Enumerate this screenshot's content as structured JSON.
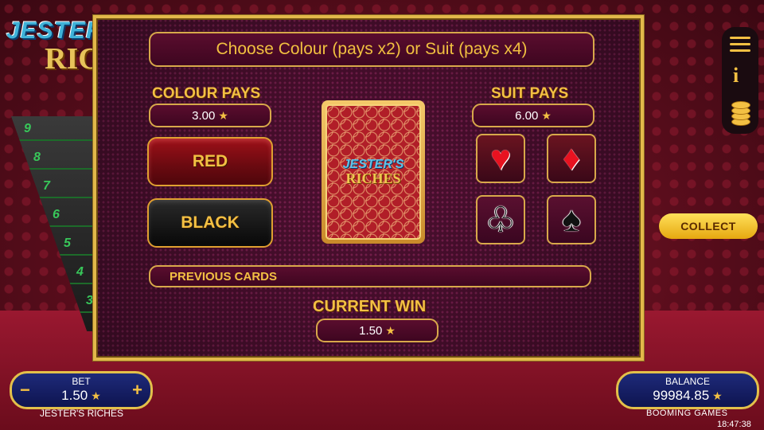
{
  "dialog": {
    "title": "Choose Colour (pays x2) or Suit (pays x4)",
    "colour_heading": "COLOUR PAYS",
    "colour_value": "3.00",
    "suit_heading": "SUIT PAYS",
    "suit_value": "6.00",
    "red_label": "RED",
    "black_label": "BLACK",
    "card_logo_line1": "JESTER'S",
    "card_logo_line2": "RICHES",
    "suits": {
      "hearts": "♥",
      "diamonds": "♦",
      "clubs": "♧",
      "spades": "♠"
    },
    "previous_cards_label": "PREVIOUS CARDS",
    "current_win_label": "CURRENT WIN",
    "current_win_value": "1.50"
  },
  "side": {
    "logo_line1": "JESTER'S",
    "logo_line2": "RICH",
    "ladder": [
      "9",
      "8",
      "7",
      "6",
      "5",
      "4",
      "3"
    ]
  },
  "hud": {
    "collect_label": "COLLECT",
    "bet_label": "BET",
    "bet_value": "1.50",
    "bet_minus": "−",
    "bet_plus": "+",
    "balance_label": "BALANCE",
    "balance_value": "99984.85",
    "game_name": "JESTER'S RICHES",
    "provider": "BOOMING GAMES",
    "clock": "18:47:38"
  },
  "colors": {
    "gold": "#f3c043",
    "red": "#e81220",
    "panel": "#1e2a7a"
  }
}
